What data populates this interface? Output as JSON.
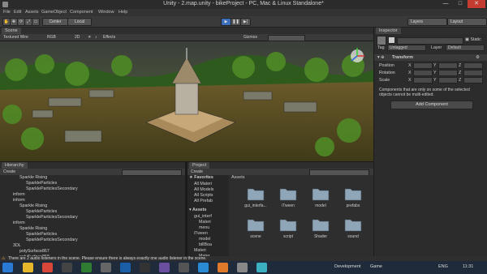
{
  "window": {
    "title": "Unity - 2.map.unity - bikeProject - PC, Mac & Linux Standalone*",
    "minimize": "—",
    "maximize": "□",
    "close": "✕"
  },
  "menu": [
    "File",
    "Edit",
    "Assets",
    "GameObject",
    "Component",
    "Window",
    "Help"
  ],
  "toolbar": {
    "pivot": "Center",
    "space": "Local",
    "layers": "Layers",
    "layout": "Layout"
  },
  "scene": {
    "tab": "Scene",
    "shading": "Textured Wire",
    "rgb": "RGB",
    "mode2d": "2D",
    "effects": "Effects",
    "gizmos": "Gizmos"
  },
  "hierarchy": {
    "tab": "Hierarchy",
    "create": "Create",
    "rows": [
      {
        "label": "Sparkle Rising",
        "indent": 3
      },
      {
        "label": "SparkleParticles",
        "indent": 4
      },
      {
        "label": "SparkleParticlesSecondary",
        "indent": 4
      },
      {
        "label": "inform",
        "indent": 2
      },
      {
        "label": "inform",
        "indent": 2
      },
      {
        "label": "Sparkle Rising",
        "indent": 3
      },
      {
        "label": "SparkleParticles",
        "indent": 4
      },
      {
        "label": "SparkleParticlesSecondary",
        "indent": 4
      },
      {
        "label": "inform",
        "indent": 2
      },
      {
        "label": "Sparkle Rising",
        "indent": 3
      },
      {
        "label": "SparkleParticles",
        "indent": 4
      },
      {
        "label": "SparkleParticlesSecondary",
        "indent": 4
      },
      {
        "label": "3DL",
        "indent": 2
      },
      {
        "label": "polySurface867",
        "indent": 3
      },
      {
        "label": "polySurface868",
        "indent": 3
      }
    ]
  },
  "project": {
    "tab": "Project",
    "create": "Create",
    "favorites": "Favorites",
    "fav_items": [
      "All Materi",
      "All Models",
      "All Scripts",
      "All Prefab"
    ],
    "assets_label": "Assets",
    "tree": [
      "gui_interf",
      "Materi",
      "menu",
      "iTween",
      "model",
      "billBoa",
      "Materi",
      "Mater"
    ],
    "folders": [
      "gui_interfa...",
      "iTween",
      "model",
      "prefabs",
      "scene",
      "script",
      "Shader",
      "sound"
    ]
  },
  "inspector": {
    "tab": "Inspector",
    "static": "Static",
    "tag_label": "Tag",
    "tag_value": "Untagged",
    "layer_label": "Layer",
    "layer_value": "Default",
    "transform": "Transform",
    "position": "Position",
    "rotation": "Rotation",
    "scale": "Scale",
    "x": "X",
    "y": "Y",
    "z": "Z",
    "note": "Components that are only on some of the selected objects cannot be multi-edited.",
    "add_component": "Add Component"
  },
  "status": {
    "message": "There are 2 audio listeners in the scene. Please ensure there is always exactly one audio listener in the scene."
  },
  "taskbar": {
    "development": "Development",
    "game": "Game",
    "lang": "ENG",
    "time": "11:31"
  }
}
